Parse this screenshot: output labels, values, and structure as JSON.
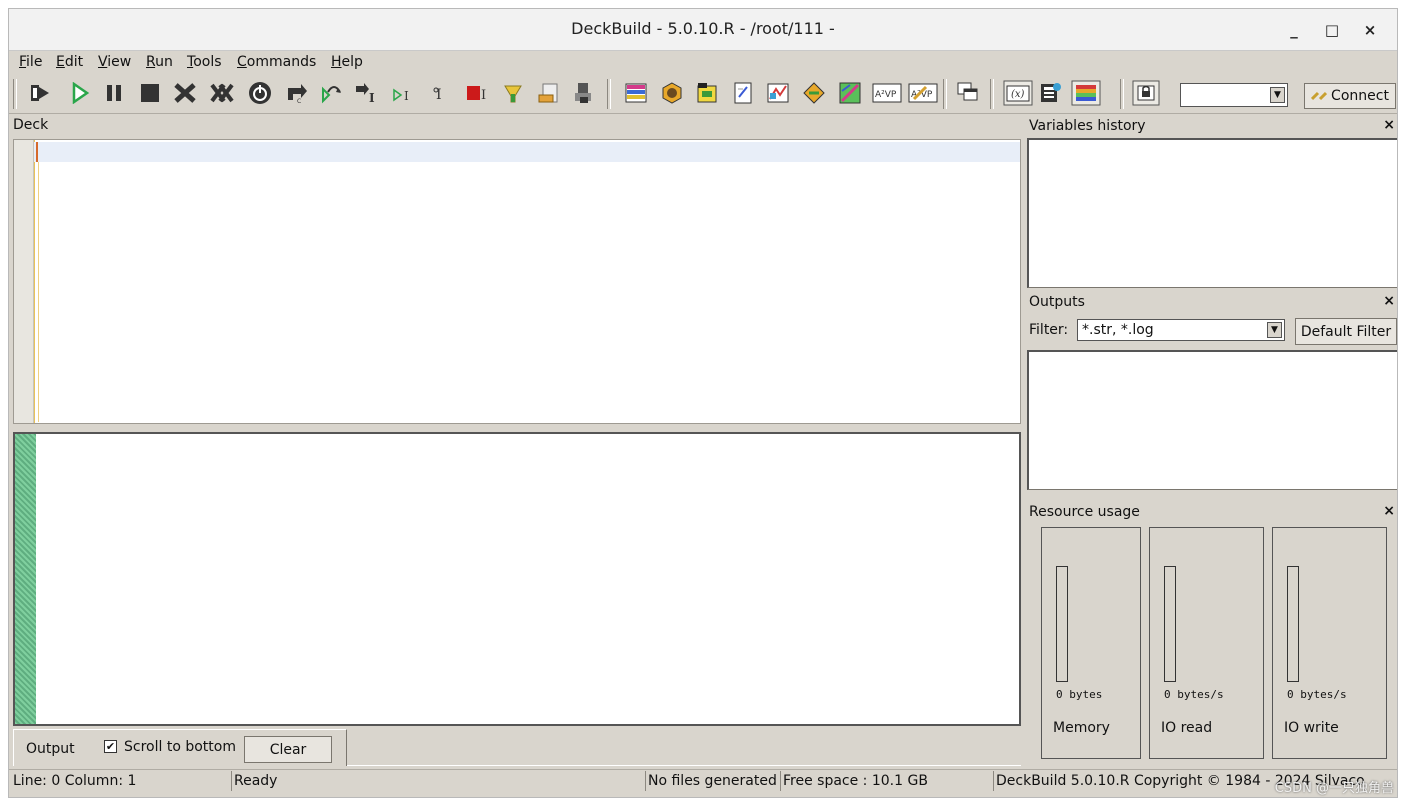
{
  "window": {
    "title": "DeckBuild - 5.0.10.R - /root/111 -",
    "minimize": "_",
    "maximize": "□",
    "close": "×"
  },
  "menu": [
    {
      "mn": "F",
      "rest": "ile"
    },
    {
      "mn": "E",
      "rest": "dit"
    },
    {
      "mn": "V",
      "rest": "iew"
    },
    {
      "mn": "R",
      "rest": "un"
    },
    {
      "mn": "T",
      "rest": "ools"
    },
    {
      "mn": "C",
      "rest": "ommands"
    },
    {
      "mn": "H",
      "rest": "elp"
    }
  ],
  "toolbar": {
    "connect_label": "Connect",
    "icons": [
      "run-deck-icon",
      "play-icon",
      "pause-icon",
      "stop-icon",
      "kill-icon",
      "kill-all-icon",
      "power-icon",
      "step-back-icon",
      "step-icon",
      "line-step-icon",
      "line-run-icon",
      "cursor-icon",
      "breakpoint-icon",
      "clean-icon",
      "script-icon",
      "export-icon",
      "structure-icon",
      "mesh-icon",
      "materials-icon",
      "notes-icon",
      "tonyplot-icon",
      "device-icon",
      "optimize-icon",
      "avp-icon",
      "avp-wizard-icon",
      "windows-icon",
      "variables-icon",
      "statistics-icon",
      "gradient-icon",
      "server-icon"
    ]
  },
  "deck": {
    "label": "Deck"
  },
  "output": {
    "tab_label": "Output",
    "scroll_label": "Scroll to bottom",
    "scroll_checked": "☒",
    "clear_label": "Clear"
  },
  "variables": {
    "title": "Variables history",
    "close": "×"
  },
  "outputs": {
    "title": "Outputs",
    "close": "×",
    "filter_label": "Filter:",
    "filter_value": "*.str, *.log",
    "default_filter_label": "Default Filter"
  },
  "resources": {
    "title": "Resource usage",
    "close": "×",
    "meters": [
      {
        "value": "0 bytes",
        "name": "Memory"
      },
      {
        "value": "0 bytes/s",
        "name": "IO read"
      },
      {
        "value": "0 bytes/s",
        "name": "IO write"
      }
    ]
  },
  "status": {
    "position": "Line: 0 Column: 1",
    "state": "Ready",
    "files": "No files generated",
    "free_space": "Free space : 10.1 GB",
    "copyright": "DeckBuild 5.0.10.R  Copyright © 1984 - 2024 Silvaco"
  },
  "watermark": "CSDN @一只独角兽",
  "colors": {
    "bg": "#d9d5cd",
    "output_gutter": "#6cc08f",
    "caret": "#d66a2c"
  }
}
